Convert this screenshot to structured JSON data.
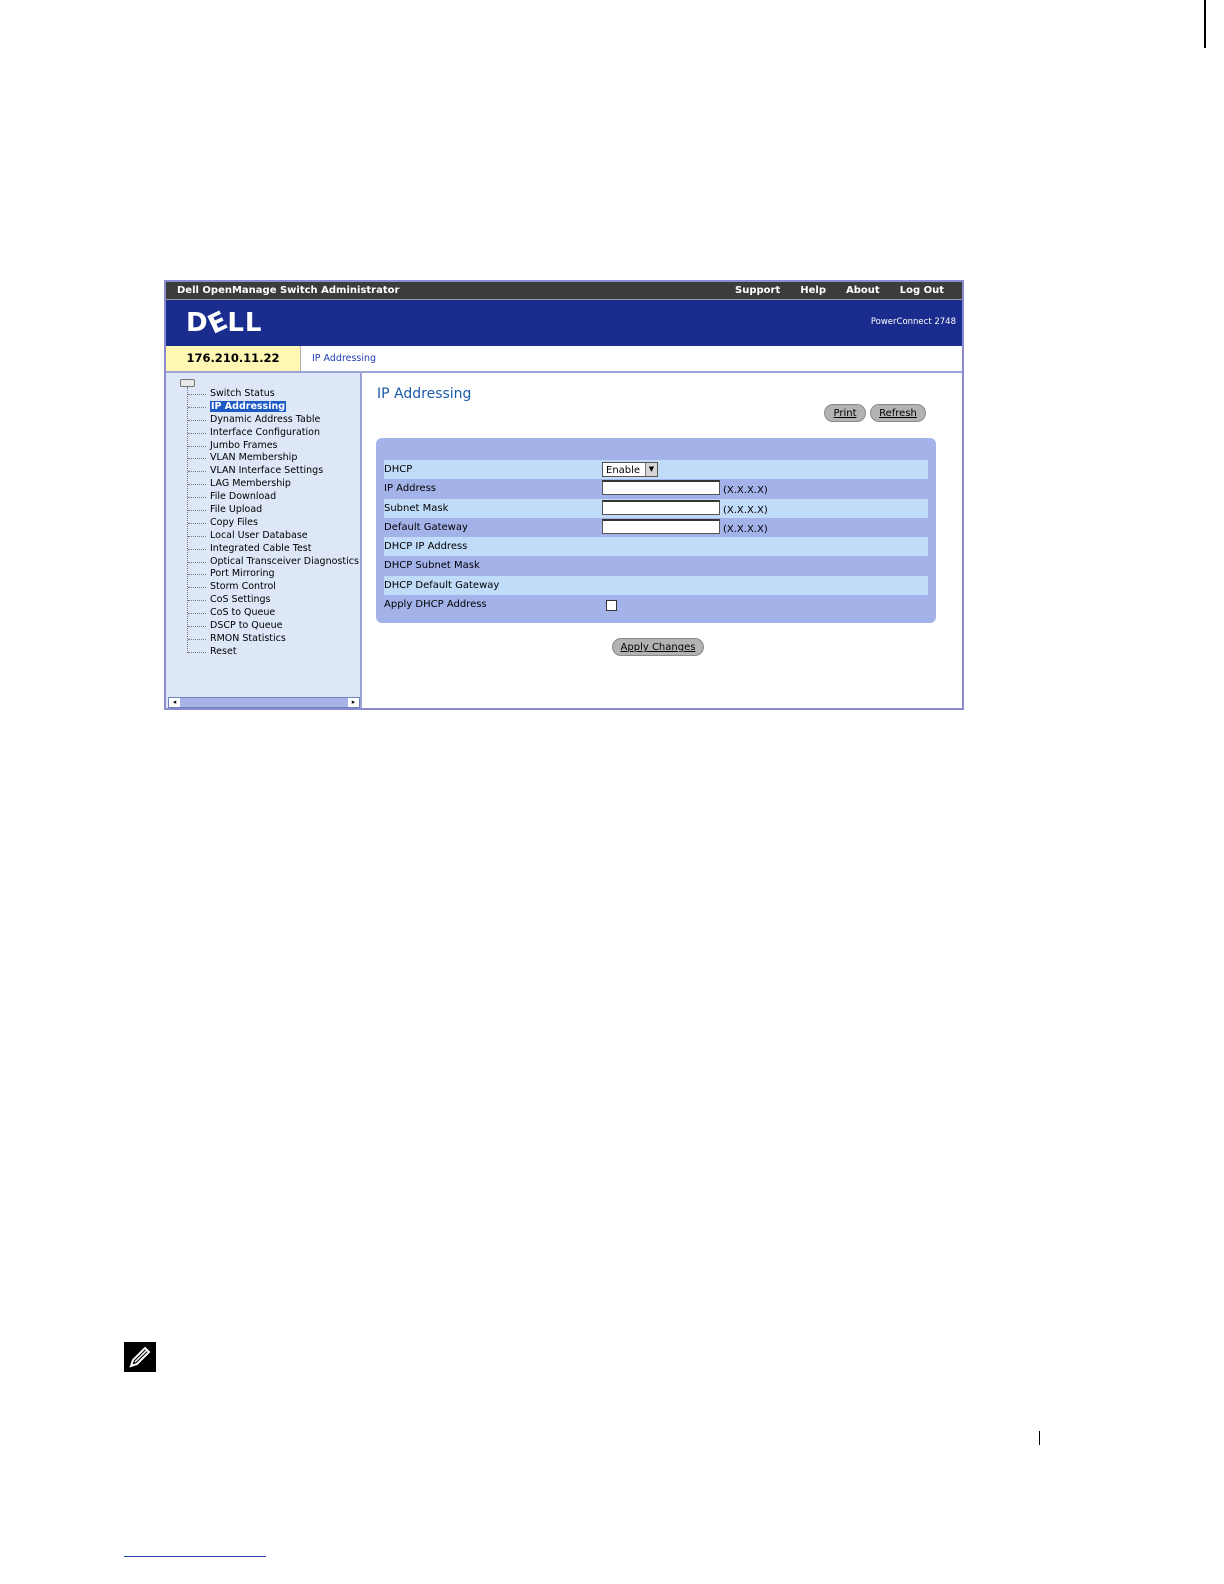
{
  "app": {
    "title": "Dell OpenManage Switch Administrator",
    "top_links": [
      "Support",
      "Help",
      "About",
      "Log Out"
    ],
    "logo_text": "D",
    "logo_tilt": "E",
    "logo_rest": "LL",
    "model": "PowerConnect 2748"
  },
  "tab": {
    "ip": "176.210.11.22",
    "breadcrumb": "IP Addressing"
  },
  "sidebar": {
    "items": [
      "Switch Status",
      "IP Addressing",
      "Dynamic Address Table",
      "Interface Configuration",
      "Jumbo Frames",
      "VLAN Membership",
      "VLAN Interface Settings",
      "LAG Membership",
      "File Download",
      "File Upload",
      "Copy Files",
      "Local User Database",
      "Integrated Cable Test",
      "Optical Transceiver Diagnostics",
      "Port Mirroring",
      "Storm Control",
      "CoS Settings",
      "CoS to Queue",
      "DSCP to Queue",
      "RMON Statistics",
      "Reset"
    ],
    "active_index": 1
  },
  "main": {
    "title": "IP Addressing",
    "print_label": "Print",
    "refresh_label": "Refresh",
    "apply_label": "Apply Changes",
    "form": {
      "dhcp_label": "DHCP",
      "dhcp_value": "Enable",
      "ip_label": "IP Address",
      "ip_value": "",
      "mask_label": "Subnet Mask",
      "mask_value": "",
      "gateway_label": "Default Gateway",
      "gateway_value": "",
      "format_hint": "(X.X.X.X)",
      "dhcp_ip_label": "DHCP IP Address",
      "dhcp_mask_label": "DHCP Subnet Mask",
      "dhcp_gateway_label": "DHCP Default Gateway",
      "apply_dhcp_label": "Apply DHCP Address",
      "apply_dhcp_checked": false
    }
  },
  "colors": {
    "banner": "#1a2d8e",
    "panel": "#a4b2ea",
    "row_light": "#c0dcf8",
    "ip_box": "#fff7b3",
    "title_blue": "#1a5aa8"
  }
}
